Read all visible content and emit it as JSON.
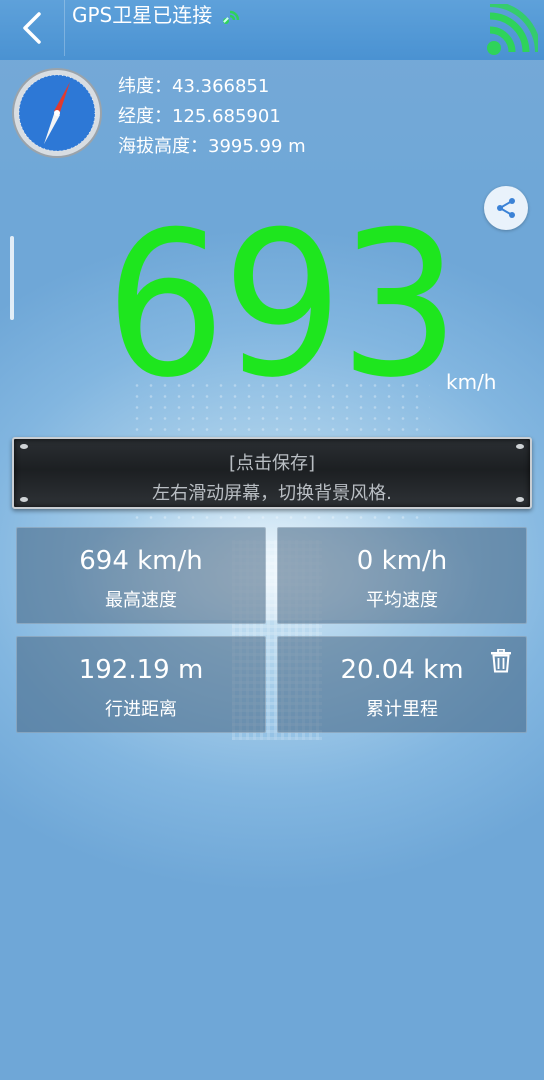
{
  "header": {
    "title": "GPS卫星已连接"
  },
  "location": {
    "latitude_label": "纬度：",
    "latitude": "43.366851",
    "longitude_label": "经度：",
    "longitude": "125.685901",
    "altitude_label": "海拔高度：",
    "altitude": "3995.99 m"
  },
  "speed": {
    "value": "693",
    "unit": "km/h"
  },
  "save_plate": {
    "title": "[点击保存]",
    "hint": "左右滑动屏幕，切换背景风格."
  },
  "stats": [
    {
      "value": "694 km/h",
      "label": "最高速度"
    },
    {
      "value": "0 km/h",
      "label": "平均速度"
    },
    {
      "value": "192.19 m",
      "label": "行进距离"
    },
    {
      "value": "20.04 km",
      "label": "累计里程"
    }
  ],
  "colors": {
    "speed": "#1ee61e",
    "header": "#4a92d2",
    "signal": "#2fd35a"
  },
  "icons": {
    "back": "chevron-left-icon",
    "satellite": "satellite-icon",
    "signal": "signal-icon",
    "compass": "compass-icon",
    "share": "share-icon",
    "trash": "trash-icon"
  }
}
